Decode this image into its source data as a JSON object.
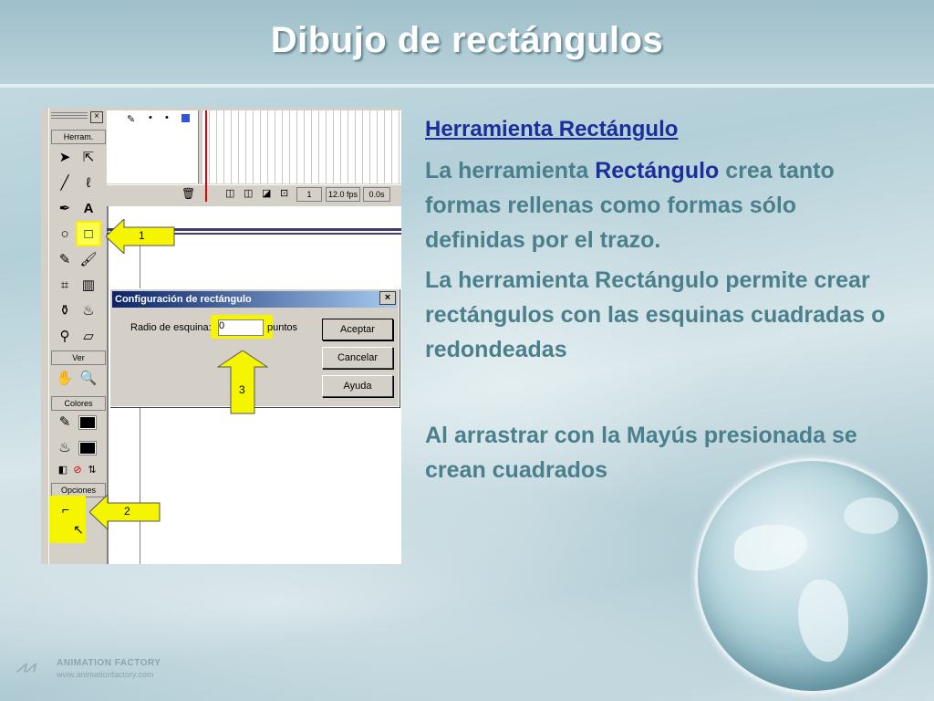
{
  "slide": {
    "title": "Dibujo de rectángulos"
  },
  "screenshot": {
    "toolbox": {
      "header": "Herram.",
      "close": "×",
      "sections": {
        "view": "Ver",
        "colors": "Colores",
        "options": "Opciones"
      }
    },
    "timeline": {
      "frame": "1",
      "fps": "12.0 fps",
      "time": "0.0s"
    },
    "dialog": {
      "title": "Configuración de rectángulo",
      "close": "×",
      "corner_label": "Radio de esquina:",
      "corner_value": "0",
      "units": "puntos",
      "ok": "Aceptar",
      "cancel": "Cancelar",
      "help": "Ayuda"
    },
    "callouts": {
      "c1": "1",
      "c2": "2",
      "c3": "3"
    }
  },
  "content": {
    "heading": "Herramienta Rectángulo",
    "p1_a": "La herramienta ",
    "p1_kw": "Rectángulo",
    "p1_b": " crea tanto formas rellenas como formas sólo definidas por el trazo.",
    "p2": "La herramienta Rectángulo permite crear rectángulos con las esquinas cuadradas o redondeadas",
    "p3": "Al arrastrar con la Mayús presionada se crean cuadrados"
  },
  "logo": {
    "name": "ANIMATION FACTORY",
    "url": "www.animationfactory.com"
  },
  "colors": {
    "title_text": "#ffffff",
    "heading": "#1c2e9c",
    "body_text": "#4a7f8c",
    "highlight": "#f5f500"
  }
}
